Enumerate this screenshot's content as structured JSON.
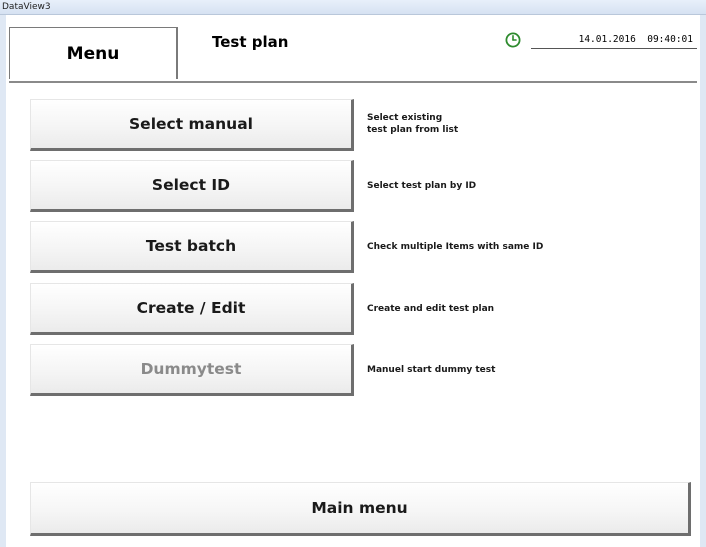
{
  "window": {
    "title": "DataView3"
  },
  "header": {
    "menu_label": "Menu",
    "page_title": "Test plan",
    "clock_icon": "clock-icon",
    "datetime": "14.01.2016  09:40:01"
  },
  "options": [
    {
      "label": "Select manual",
      "description": "Select existing\ntest plan from list",
      "enabled": true
    },
    {
      "label": "Select ID",
      "description": "Select test plan by ID",
      "enabled": true
    },
    {
      "label": "Test batch",
      "description": "Check multiple Items with same ID",
      "enabled": true
    },
    {
      "label": "Create / Edit",
      "description": "Create and edit test plan",
      "enabled": true
    },
    {
      "label": "Dummytest",
      "description": "Manuel start dummy test",
      "enabled": false
    }
  ],
  "footer": {
    "main_menu_label": "Main menu"
  },
  "colors": {
    "clock_green": "#2e8b2e",
    "disabled_text": "#8a8a8a"
  }
}
